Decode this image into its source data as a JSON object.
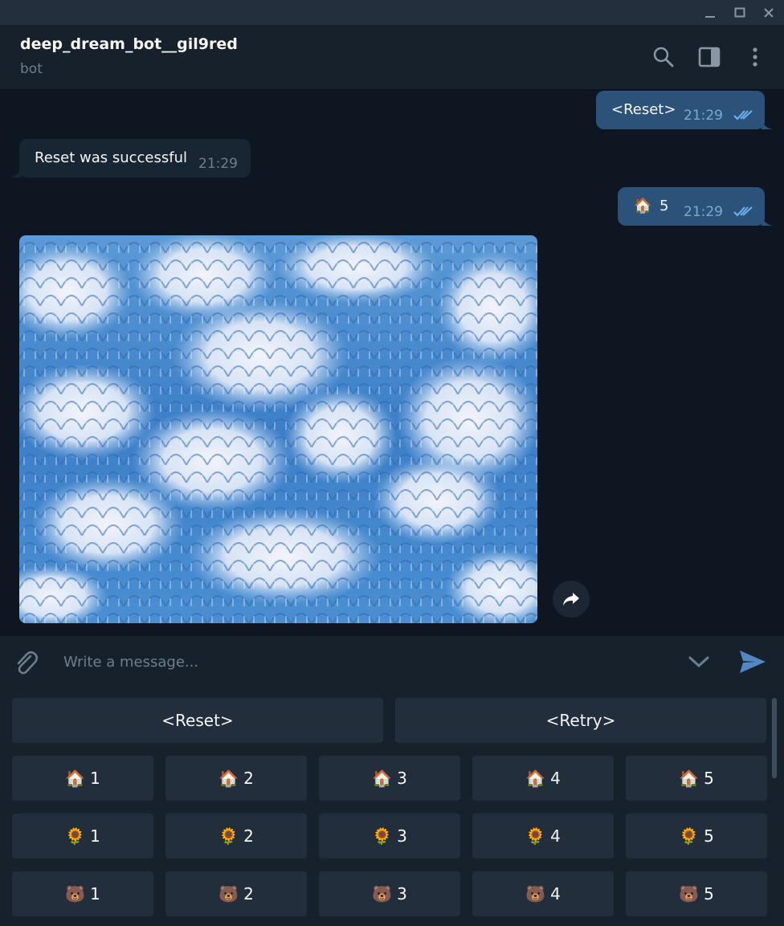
{
  "header": {
    "title": "deep_dream_bot__gil9red",
    "subtitle": "bot"
  },
  "messages": [
    {
      "direction": "out",
      "text": "<Reset>",
      "time": "21:29",
      "status": "read"
    },
    {
      "direction": "in",
      "text": "Reset was successful",
      "time": "21:29"
    },
    {
      "direction": "out",
      "emoji": "🏠",
      "text": "5",
      "time": "21:29",
      "status": "read"
    },
    {
      "direction": "in",
      "type": "photo",
      "description": "deep dream image"
    }
  ],
  "composer": {
    "placeholder": "Write a message..."
  },
  "keyboard": {
    "reset_label": "<Reset>",
    "retry_label": "<Retry>",
    "rows": [
      {
        "emoji": "🏠",
        "numbers": [
          "1",
          "2",
          "3",
          "4",
          "5"
        ]
      },
      {
        "emoji": "🌻",
        "numbers": [
          "1",
          "2",
          "3",
          "4",
          "5"
        ]
      },
      {
        "emoji": "🐻",
        "numbers": [
          "1",
          "2",
          "3",
          "4",
          "5"
        ]
      }
    ]
  },
  "colors": {
    "background": "#0e1621",
    "panel": "#17212b",
    "outgoing_bubble": "#2b5278",
    "incoming_bubble": "#182533",
    "accent": "#5288c1"
  },
  "icons": {
    "minimize": "minimize-icon",
    "maximize": "maximize-icon",
    "close": "close-icon",
    "search": "search-icon",
    "sidebar": "sidebar-toggle-icon",
    "more": "more-vertical-icon",
    "attach": "paperclip-icon",
    "scroll_down": "chevron-down-icon",
    "send": "send-icon",
    "share": "share-icon",
    "read": "double-check-icon"
  }
}
